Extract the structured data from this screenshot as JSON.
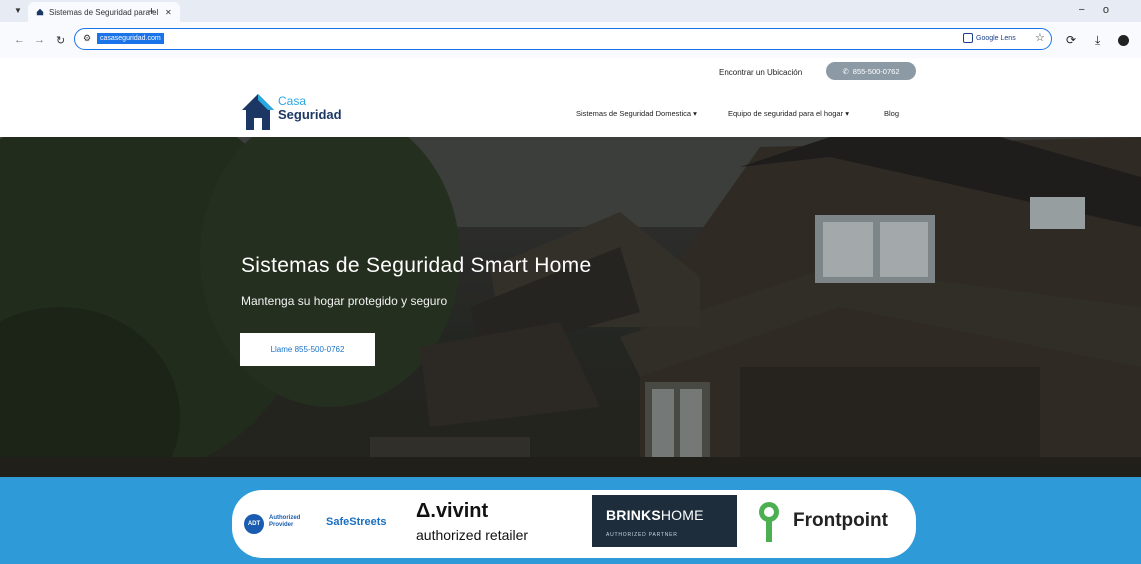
{
  "browser": {
    "tab_title": "Sistemas de Seguridad para el",
    "url": "casaseguridad.com",
    "lens_label": "Google Lens",
    "window_controls": [
      "−",
      "o"
    ]
  },
  "site": {
    "find_location": "Encontrar un Ubicación",
    "phone_button": "855-500-0762",
    "logo_line1": "Casa",
    "logo_line2": "Seguridad",
    "nav": [
      {
        "label": "Sistemas de Seguridad Domestica",
        "dropdown": true
      },
      {
        "label": "Equipo de seguridad para el hogar",
        "dropdown": true
      },
      {
        "label": "Blog",
        "dropdown": false
      }
    ]
  },
  "hero": {
    "title": "Sistemas de Seguridad Smart Home",
    "subtitle": "Mantenga su hogar protegido y seguro",
    "cta": "Llame 855-500-0762"
  },
  "partners": {
    "adt_badge": "ADT",
    "adt_text": "Authorized Provider",
    "safestreets": "SafeStreets",
    "vivint": "vivint",
    "vivint_sub": "authorized retailer",
    "brinks_bold": "BRINKS",
    "brinks_light": "HOME",
    "brinks_sub": "AUTHORIZED PARTNER",
    "frontpoint": "Frontpoint"
  },
  "colors": {
    "accent_blue": "#2e9ad8",
    "logo_navy": "#1c3764",
    "logo_light_blue": "#2aa8e0",
    "omnibox_border": "#1a73e8",
    "frontpoint_green": "#4caf50"
  }
}
